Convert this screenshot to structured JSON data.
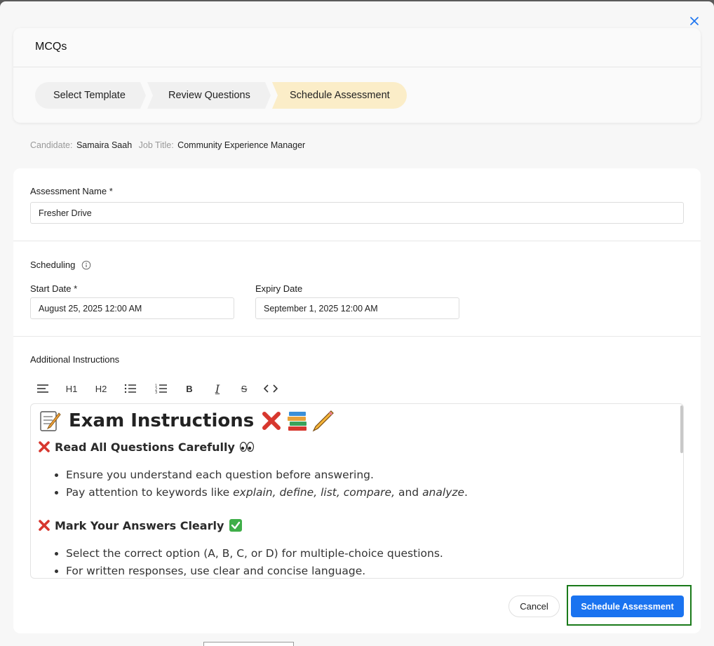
{
  "modal": {
    "title": "MCQs",
    "steps": [
      {
        "label": "Select Template",
        "state": "done"
      },
      {
        "label": "Review Questions",
        "state": "done"
      },
      {
        "label": "Schedule Assessment",
        "state": "active"
      }
    ],
    "active_step_color": "#fbedc8"
  },
  "meta": {
    "candidate_label": "Candidate:",
    "candidate_value": "Samaira Saah",
    "job_label": "Job Title:",
    "job_value": "Community Experience Manager"
  },
  "form": {
    "assessment_name_label": "Assessment Name *",
    "assessment_name_value": "Fresher Drive",
    "scheduling_label": "Scheduling",
    "start_date_label": "Start Date *",
    "start_date_value": "August 25, 2025 12:00 AM",
    "expiry_date_label": "Expiry Date",
    "expiry_date_value": "September 1, 2025 12:00 AM",
    "instructions_label": "Additional Instructions"
  },
  "toolbar": {
    "paragraph_icon": "align-left-icon",
    "h1": "H1",
    "h2": "H2",
    "bullet_icon": "bullet-list-icon",
    "ordered_icon": "ordered-list-icon",
    "bold": "B",
    "italic": "I",
    "strike": "S",
    "code_icon": "code-icon"
  },
  "editor": {
    "heading": "Exam Instructions",
    "section1_title": "Read All Questions Carefully",
    "section1_items": {
      "item1": "Ensure you understand each question before answering.",
      "item2_prefix": "Pay attention to keywords like ",
      "kw1": "explain,",
      "kw2": "define,",
      "kw3": "list,",
      "kw4": "compare,",
      "and": "and",
      "kw5": "analyze",
      "end": "."
    },
    "section2_title": "Mark Your Answers Clearly",
    "section2_items": {
      "item1": "Select the correct option (A, B, C, or D) for multiple-choice questions.",
      "item2": "For written responses, use clear and concise language."
    }
  },
  "actions": {
    "cancel": "Cancel",
    "submit": "Schedule Assessment",
    "primary_color": "#1a73f0",
    "highlight_color": "#1a7a1a"
  }
}
